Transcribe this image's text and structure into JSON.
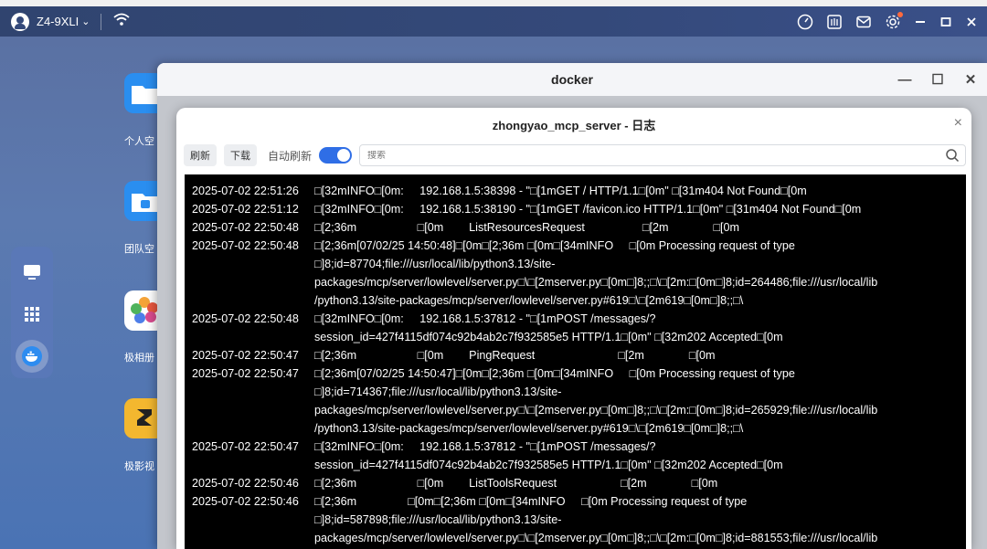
{
  "topbar": {
    "device_name": "Z4-9XLI",
    "device_chevron": "⌄"
  },
  "desktop": {
    "icons": [
      {
        "label": "个人空"
      },
      {
        "label": "团队空"
      },
      {
        "label": "极相册"
      },
      {
        "label": "极影视"
      }
    ]
  },
  "docker_window": {
    "title": "docker",
    "minimize": "—",
    "maximize": "☐",
    "close": "✕"
  },
  "log_dialog": {
    "title": "zhongyao_mcp_server - 日志",
    "close": "×",
    "refresh_label": "刷新",
    "download_label": "下载",
    "auto_refresh_label": "自动刷新",
    "auto_refresh_on": true,
    "search_placeholder": "搜索"
  },
  "logs": [
    {
      "ts": "2025-07-02 22:51:26",
      "msg": "□[32mINFO□[0m:     192.168.1.5:38398 - \"□[1mGET / HTTP/1.1□[0m\" □[31m404 Not Found□[0m"
    },
    {
      "ts": "2025-07-02 22:51:12",
      "msg": "□[32mINFO□[0m:     192.168.1.5:38190 - \"□[1mGET /favicon.ico HTTP/1.1□[0m\" □[31m404 Not Found□[0m"
    },
    {
      "ts": "2025-07-02 22:50:48",
      "msg": "□[2;36m                   □[0m        ListResourcesRequest                  □[2m              □[0m"
    },
    {
      "ts": "2025-07-02 22:50:48",
      "msg": "□[2;36m[07/02/25 14:50:48]□[0m□[2;36m □[0m□[34mINFO     □[0m Processing request of type"
    },
    {
      "ts": "",
      "msg": "□]8;id=87704;file:///usr/local/lib/python3.13/site-"
    },
    {
      "ts": "",
      "msg": "packages/mcp/server/lowlevel/server.py□\\□[2mserver.py□[0m□]8;;□\\□[2m:□[0m□]8;id=264486;file:///usr/local/lib"
    },
    {
      "ts": "",
      "msg": "/python3.13/site-packages/mcp/server/lowlevel/server.py#619□\\□[2m619□[0m□]8;;□\\"
    },
    {
      "ts": "2025-07-02 22:50:48",
      "msg": "□[32mINFO□[0m:     192.168.1.5:37812 - \"□[1mPOST /messages/?"
    },
    {
      "ts": "",
      "msg": "session_id=427f4115df074c92b4ab2c7f932585e5 HTTP/1.1□[0m\" □[32m202 Accepted□[0m"
    },
    {
      "ts": "2025-07-02 22:50:47",
      "msg": "□[2;36m                   □[0m        PingRequest                          □[2m              □[0m"
    },
    {
      "ts": "2025-07-02 22:50:47",
      "msg": "□[2;36m[07/02/25 14:50:47]□[0m□[2;36m □[0m□[34mINFO     □[0m Processing request of type"
    },
    {
      "ts": "",
      "msg": "□]8;id=714367;file:///usr/local/lib/python3.13/site-"
    },
    {
      "ts": "",
      "msg": "packages/mcp/server/lowlevel/server.py□\\□[2mserver.py□[0m□]8;;□\\□[2m:□[0m□]8;id=265929;file:///usr/local/lib"
    },
    {
      "ts": "",
      "msg": "/python3.13/site-packages/mcp/server/lowlevel/server.py#619□\\□[2m619□[0m□]8;;□\\"
    },
    {
      "ts": "2025-07-02 22:50:47",
      "msg": "□[32mINFO□[0m:     192.168.1.5:37812 - \"□[1mPOST /messages/?"
    },
    {
      "ts": "",
      "msg": "session_id=427f4115df074c92b4ab2c7f932585e5 HTTP/1.1□[0m\" □[32m202 Accepted□[0m"
    },
    {
      "ts": "2025-07-02 22:50:46",
      "msg": "□[2;36m                   □[0m        ListToolsRequest                    □[2m              □[0m"
    },
    {
      "ts": "2025-07-02 22:50:46",
      "msg": "□[2;36m                □[0m□[2;36m □[0m□[34mINFO     □[0m Processing request of type"
    },
    {
      "ts": "",
      "msg": "□]8;id=587898;file:///usr/local/lib/python3.13/site-"
    },
    {
      "ts": "",
      "msg": "packages/mcp/server/lowlevel/server.py□\\□[2mserver.py□[0m□]8;;□\\□[2m:□[0m□]8;id=881553;file:///usr/local/lib"
    }
  ]
}
